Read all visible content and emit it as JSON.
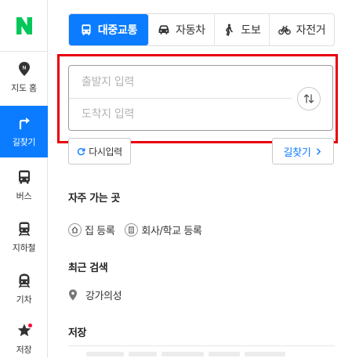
{
  "sidebar": {
    "logo": "N",
    "items": [
      {
        "label": "지도 홈",
        "icon": "map-home-pin-icon",
        "active": false
      },
      {
        "label": "길찾기",
        "icon": "directions-arrow-icon",
        "active": true
      },
      {
        "label": "버스",
        "icon": "bus-icon",
        "active": false
      },
      {
        "label": "지하철",
        "icon": "subway-icon",
        "active": false
      },
      {
        "label": "기차",
        "icon": "train-icon",
        "active": false
      },
      {
        "label": "저장",
        "icon": "star-icon",
        "active": false
      }
    ]
  },
  "mode_tabs": [
    {
      "label": "대중교통",
      "icon": "bus-icon",
      "active": true
    },
    {
      "label": "자동차",
      "icon": "car-icon",
      "active": false
    },
    {
      "label": "도보",
      "icon": "walk-icon",
      "active": false
    },
    {
      "label": "자전거",
      "icon": "bicycle-icon",
      "active": false
    }
  ],
  "route": {
    "start_placeholder": "출발지 입력",
    "end_placeholder": "도착지 입력",
    "start_value": "",
    "end_value": ""
  },
  "actions": {
    "reset_label": "다시입력",
    "search_label": "길찾기"
  },
  "favorites": {
    "title": "자주 가는 곳",
    "items": [
      {
        "label": "집 등록",
        "icon": "home-icon"
      },
      {
        "label": "회사/학교 등록",
        "icon": "building-icon"
      }
    ]
  },
  "recent": {
    "title": "최근 검색",
    "items": [
      {
        "label": "강가의성",
        "icon": "location-pin-icon"
      }
    ]
  },
  "saved": {
    "title": "저장"
  },
  "colors": {
    "accent": "#0b7cff",
    "brand_green": "#03c75a",
    "highlight_red": "#e8000b",
    "notification_dot": "#ff0033"
  }
}
